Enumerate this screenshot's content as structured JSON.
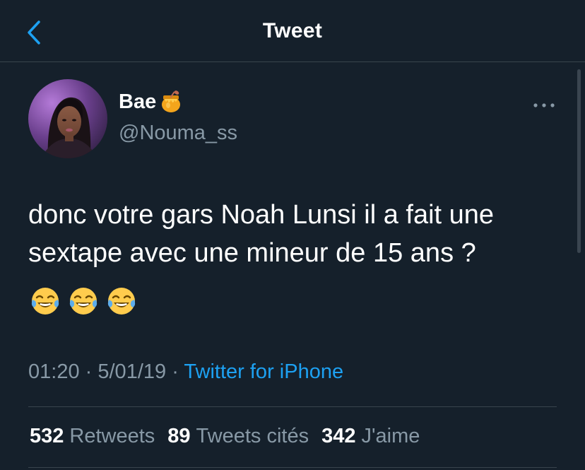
{
  "header": {
    "title": "Tweet",
    "back_icon": "chevron-left-icon"
  },
  "user": {
    "display_name": "Bae",
    "name_emoji": "honey-pot-icon",
    "handle": "@Nouma_ss"
  },
  "tweet": {
    "text_lines": [
      "donc votre gars Noah Lunsi il a fait une",
      "sextape avec une mineur de 15 ans ?"
    ],
    "emojis": [
      "laughing-tears-emoji",
      "laughing-tears-emoji",
      "laughing-tears-emoji"
    ],
    "time": "01:20",
    "date": "5/01/19",
    "source": "Twitter for iPhone",
    "separator": "·"
  },
  "stats": {
    "retweets_count": "532",
    "retweets_label": "Retweets",
    "quotes_count": "89",
    "quotes_label": "Tweets cités",
    "likes_count": "342",
    "likes_label": "J'aime"
  },
  "colors": {
    "background": "#15202b",
    "accent": "#1da1f2",
    "secondary_text": "#8899a6",
    "divider": "#38444d"
  }
}
